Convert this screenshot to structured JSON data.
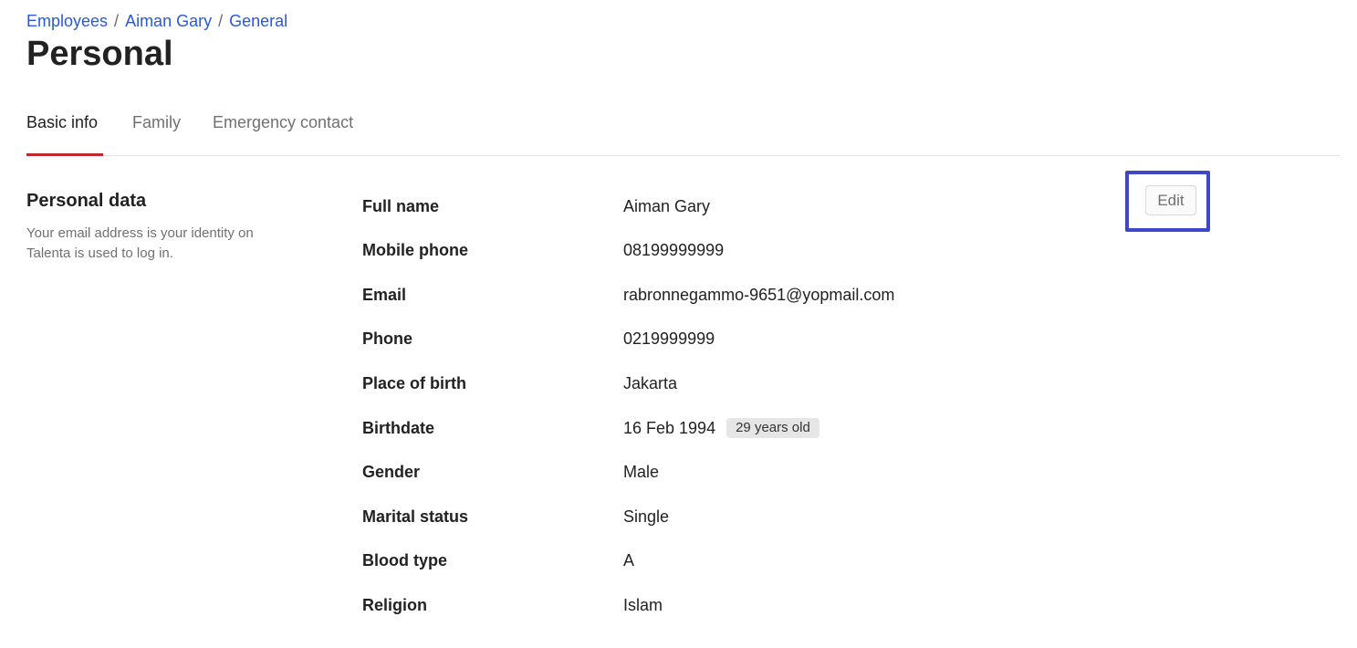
{
  "breadcrumb": {
    "items": [
      "Employees",
      "Aiman Gary",
      "General"
    ],
    "separator": "/"
  },
  "page_title": "Personal",
  "tabs": [
    {
      "label": "Basic info",
      "active": true
    },
    {
      "label": "Family",
      "active": false
    },
    {
      "label": "Emergency contact",
      "active": false
    }
  ],
  "section": {
    "title": "Personal data",
    "description": "Your email address is your identity on Talenta is used to log in.",
    "edit_label": "Edit"
  },
  "fields": [
    {
      "label": "Full name",
      "value": "Aiman Gary"
    },
    {
      "label": "Mobile phone",
      "value": "08199999999"
    },
    {
      "label": "Email",
      "value": "rabronnegammo-9651@yopmail.com"
    },
    {
      "label": "Phone",
      "value": "0219999999"
    },
    {
      "label": "Place of birth",
      "value": "Jakarta"
    },
    {
      "label": "Birthdate",
      "value": "16 Feb 1994",
      "badge": "29 years old"
    },
    {
      "label": "Gender",
      "value": "Male"
    },
    {
      "label": "Marital status",
      "value": "Single"
    },
    {
      "label": "Blood type",
      "value": "A"
    },
    {
      "label": "Religion",
      "value": "Islam"
    }
  ],
  "colors": {
    "link": "#2a58d9",
    "tab_active_underline": "#c0282f",
    "highlight_border": "#3f47c9",
    "badge_bg": "#e6e6e6"
  }
}
